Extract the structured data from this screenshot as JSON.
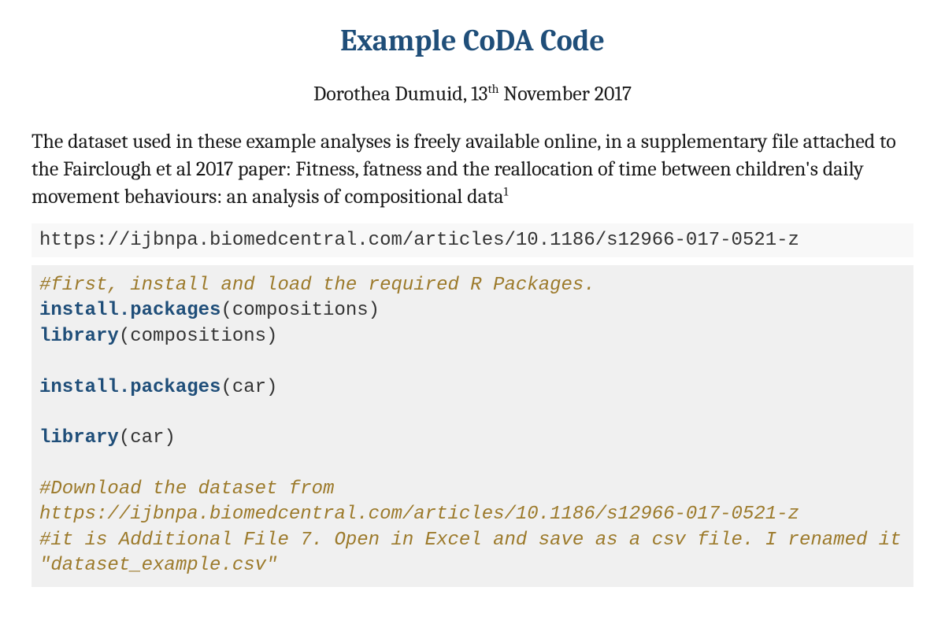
{
  "title": "Example CoDA Code",
  "byline_author": "Dorothea Dumuid, 13",
  "byline_ord": "th",
  "byline_date": " November 2017",
  "intro_text": "The dataset used in these example analyses is freely available online, in a supplementary file attached to the Fairclough et al 2017 paper: Fitness, fatness and the reallocation of time between children's daily movement behaviours: an analysis of compositional data",
  "intro_footnote": "1",
  "url": "https://ijbnpa.biomedcentral.com/articles/10.1186/s12966-017-0521-z",
  "code": {
    "c1": "#first, install and load the required R Packages.",
    "k1": "install.packages",
    "p1": "(compositions)",
    "k2": "library",
    "p2": "(compositions)",
    "k3": "install.packages",
    "p3": "(car)",
    "k4": "library",
    "p4": "(car)",
    "c2": "#Download the dataset from https://ijbnpa.biomedcentral.com/articles/10.1186/s12966-017-0521-z",
    "c3": "#it is Additional File 7. Open in Excel and save as a csv file. I renamed it \"dataset_example.csv\""
  }
}
